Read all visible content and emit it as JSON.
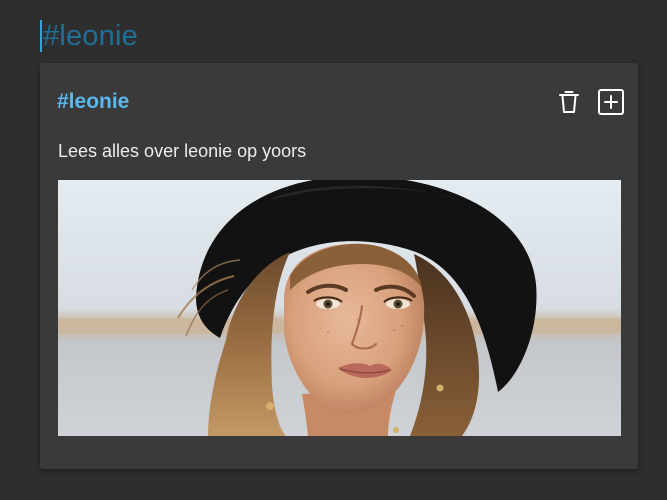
{
  "editor": {
    "title": "#leonie"
  },
  "card": {
    "title": "#leonie",
    "description": "Lees alles over leonie op yoors",
    "image_alt": "Portrait photo of a woman wearing a black hat",
    "actions": {
      "delete_icon": "trash-icon",
      "add_icon": "plus-square-icon"
    }
  },
  "colors": {
    "background": "#2e2e2e",
    "card_background": "#3a3a3a",
    "title_dark_blue": "#1f6f9a",
    "title_light_blue": "#5bb8ec",
    "text": "#ececec"
  }
}
